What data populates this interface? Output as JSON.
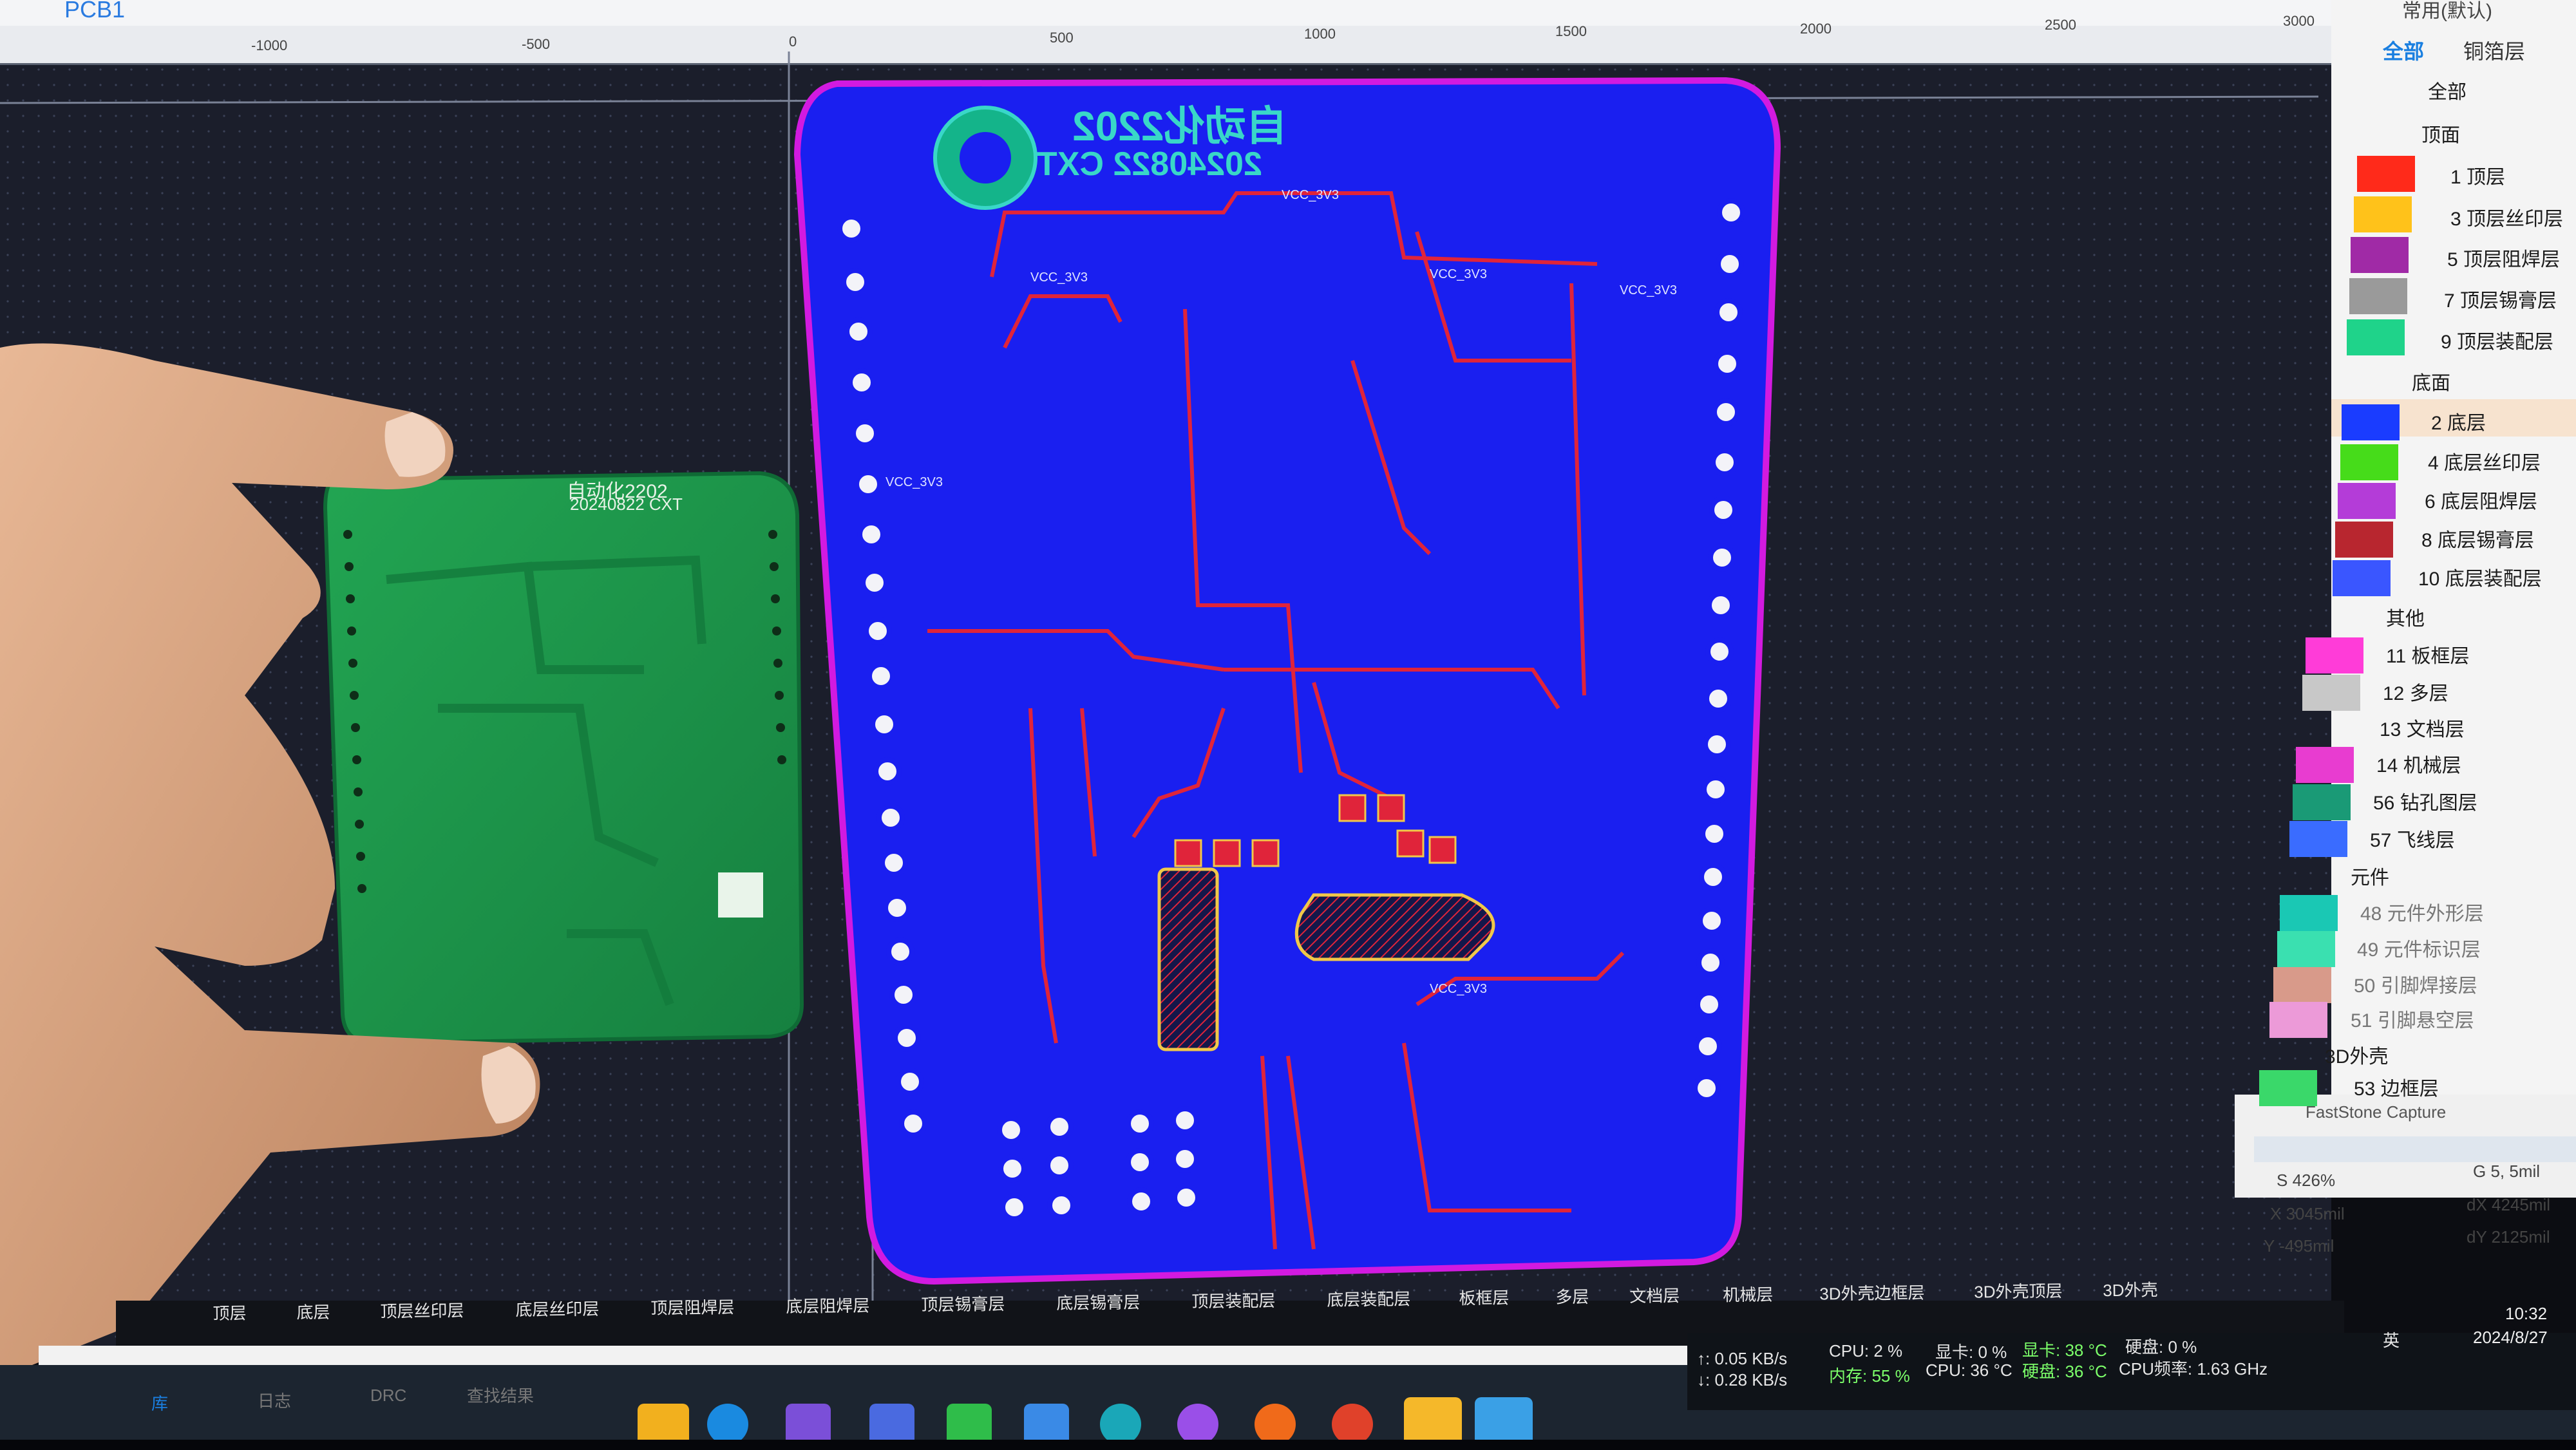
{
  "scene": {
    "description_colors": {
      "monitor_bg": "#1b1e2b",
      "pcb_blue": "#1a1ff0",
      "board_outline": "#d21ae0",
      "trace_red": "#e0243a",
      "physical_pcb": "#1f9a4a",
      "hand_skin": "#d6a07c",
      "panel_bg": "#f4f4f4",
      "taskbar": "#1c2530"
    }
  },
  "editor": {
    "document_tab": "PCB1",
    "ruler_ticks": [
      "-1000",
      "-500",
      "0",
      "500",
      "1000",
      "1500",
      "2000",
      "2500",
      "3000"
    ],
    "silkscreen_line1": "自动化2202",
    "silkscreen_line2": "20240822 CXT",
    "net_labels": [
      "VCC_3V3",
      "VCC_3V3",
      "VCC_3V3",
      "VCC_3V3",
      "VCC_3V3",
      "VCC_3V3"
    ]
  },
  "physical_board": {
    "line1": "自动化2202",
    "line2": "20240822 CXT"
  },
  "layer_panel": {
    "header": "常用(默认)",
    "tabs": [
      "全部",
      "铜箔层"
    ],
    "items": [
      {
        "label": "全部",
        "color": ""
      },
      {
        "label": "顶面",
        "color": ""
      },
      {
        "label": "1 顶层",
        "color": "#ff2a1a"
      },
      {
        "label": "3 顶层丝印层",
        "color": "#ffc21a"
      },
      {
        "label": "5 顶层阻焊层",
        "color": "#a02aa6"
      },
      {
        "label": "7 顶层锡膏层",
        "color": "#9a9a9a"
      },
      {
        "label": "9 顶层装配层",
        "color": "#1fd38a"
      },
      {
        "label": "底面",
        "color": ""
      },
      {
        "label": "2 底层",
        "color": "#1a3cff"
      },
      {
        "label": "4 底层丝印层",
        "color": "#46dc1a"
      },
      {
        "label": "6 底层阻焊层",
        "color": "#b43cd8"
      },
      {
        "label": "8 底层锡膏层",
        "color": "#b8262f"
      },
      {
        "label": "10 底层装配层",
        "color": "#3a56ff"
      },
      {
        "label": "其他",
        "color": ""
      },
      {
        "label": "11 板框层",
        "color": "#ff3cd8"
      },
      {
        "label": "12 多层",
        "color": "#c8c8c8"
      },
      {
        "label": "13 文档层",
        "color": "#ffffff"
      },
      {
        "label": "14 机械层",
        "color": "#e83cd0"
      },
      {
        "label": "56 钻孔图层",
        "color": "#1a9a76"
      },
      {
        "label": "57 飞线层",
        "color": "#3a6cff"
      },
      {
        "label": "元件",
        "color": ""
      },
      {
        "label": "48 元件外形层",
        "color": "#1ac8b4"
      },
      {
        "label": "49 元件标识层",
        "color": "#3ae0b0"
      },
      {
        "label": "50 引脚焊接层",
        "color": "#d89a8a"
      },
      {
        "label": "51 引脚悬空层",
        "color": "#ec9ad8"
      },
      {
        "label": "3D外壳",
        "color": ""
      },
      {
        "label": "53 边框层",
        "color": "#3ad86a"
      }
    ],
    "capture_tool": "FastStone Capture"
  },
  "readouts": {
    "s": "S  426%",
    "g": "G  5, 5mil",
    "x": "X  3045mil",
    "dx": "dX  4245mil",
    "y": "Y  -495mil",
    "dy": "dY  2125mil"
  },
  "bottom_layer_tabs": [
    "顶层",
    "底层",
    "顶层丝印层",
    "底层丝印层",
    "顶层阻焊层",
    "底层阻焊层",
    "顶层锡膏层",
    "底层锡膏层",
    "顶层装配层",
    "底层装配层",
    "板框层",
    "多层",
    "文档层",
    "机械层",
    "3D外壳边框层",
    "3D外壳顶层",
    "3D外壳"
  ],
  "bottom_panel_tabs": [
    "库",
    "日志",
    "DRC",
    "查找结果"
  ],
  "system_status": {
    "net_up": "↑: 0.05 KB/s",
    "net_down": "↓: 0.28 KB/s",
    "cpu": "CPU: 2 %",
    "gpu": "显卡: 0 %",
    "gpu_temp": "显卡: 38 °C",
    "disk": "硬盘: 0 %",
    "mem": "内存: 55 %",
    "cpu_temp": "CPU: 36 °C",
    "disk_temp": "硬盘: 36 °C",
    "cpu_freq": "CPU频率: 1.63 GHz",
    "ime": "英",
    "time": "10:32",
    "date": "2024/8/27"
  }
}
